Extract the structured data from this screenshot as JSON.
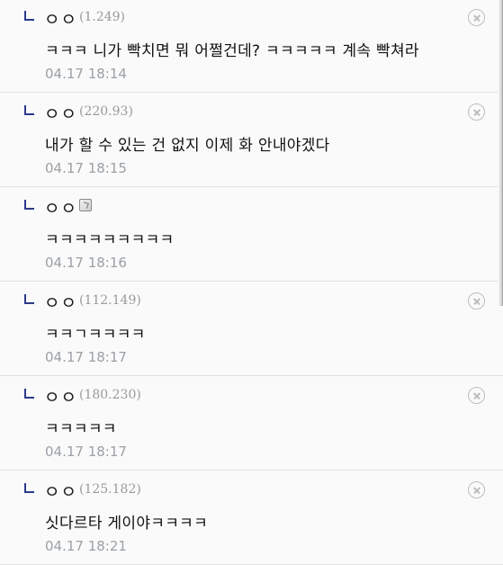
{
  "comments": [
    {
      "nick": "ㅇㅇ",
      "ip": "(1.249)",
      "text": "ㅋㅋㅋ 니가 빡치면 뭐 어쩔건데? ㅋㅋㅋㅋㅋ 계속 빡쳐라",
      "time": "04.17 18:14"
    },
    {
      "nick": "ㅇㅇ",
      "ip": "(220.93)",
      "text": "내가 할 수 있는 건 없지 이제 화 안내야겠다",
      "time": "04.17 18:15"
    },
    {
      "nick": "ㅇㅇ",
      "ip": "",
      "icon": "member-badge-icon",
      "text": "ㅋㅋㅋㅋㅋㅋㅋㅋㅋ",
      "time": "04.17 18:16"
    },
    {
      "nick": "ㅇㅇ",
      "ip": "(112.149)",
      "text": "ㅋㅋㄱㅋㅋㅋㅋ",
      "time": "04.17 18:17"
    },
    {
      "nick": "ㅇㅇ",
      "ip": "(180.230)",
      "text": "ㅋㅋㅋㅋㅋ",
      "time": "04.17 18:17"
    },
    {
      "nick": "ㅇㅇ",
      "ip": "(125.182)",
      "text": "싯다르타 게이야ㅋㅋㅋㅋ",
      "time": "04.17 18:21"
    }
  ],
  "icons": {
    "reply": "reply-arrow-icon",
    "delete": "close-circle-icon"
  },
  "colors": {
    "reply_arrow": "#2d3a8c",
    "meta_text": "#9aa0a6",
    "divider": "#e2e2e2"
  }
}
